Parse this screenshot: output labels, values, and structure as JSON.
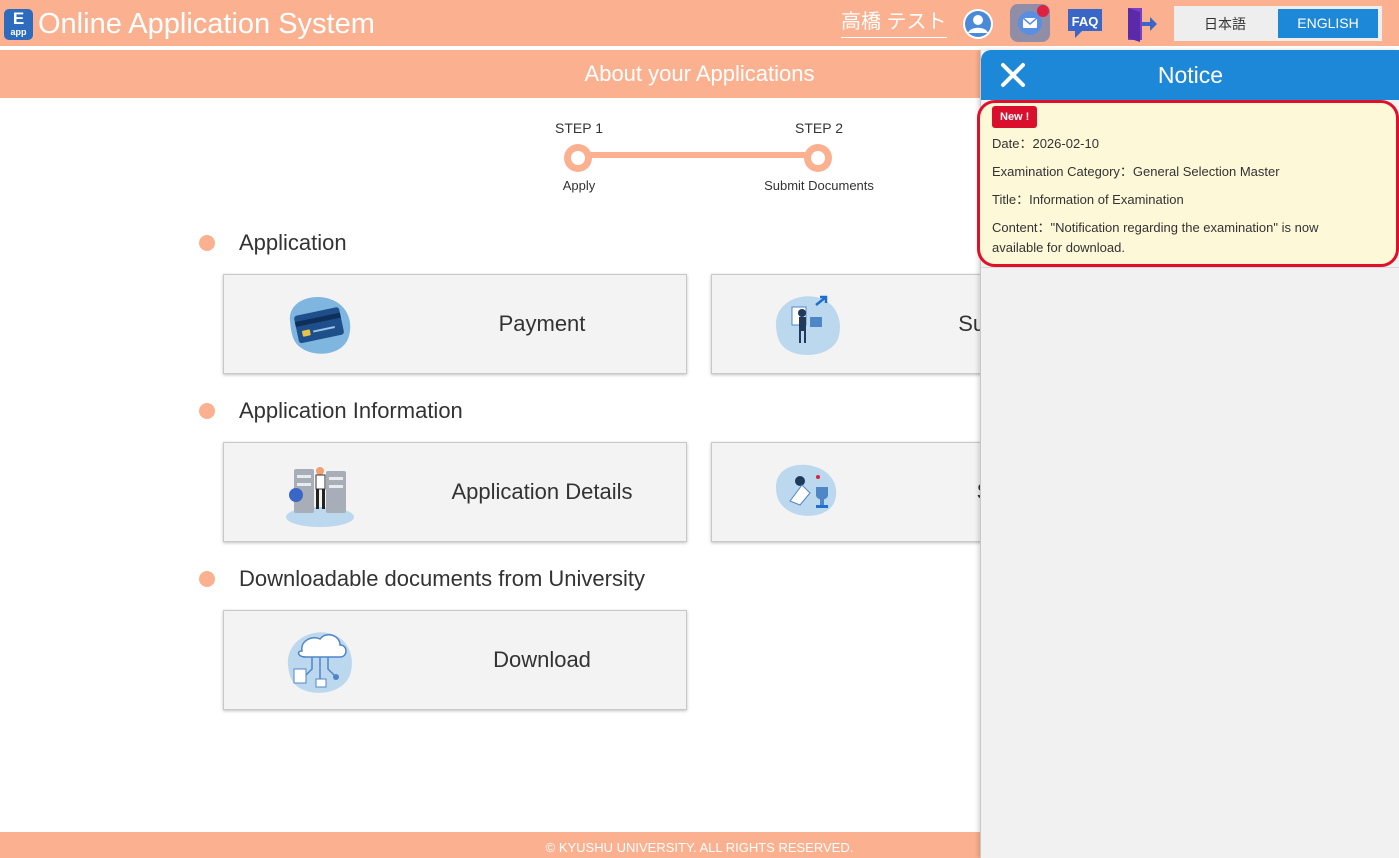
{
  "header": {
    "logo_letter": "E",
    "logo_sub": "app",
    "title": "Online Application System",
    "user_name": "高橋 テスト",
    "faq_label": "FAQ",
    "lang_ja": "日本語",
    "lang_en": "ENGLISH",
    "accent_color": "#fbb18f",
    "active_lang_color": "#1e88d8"
  },
  "band": {
    "title": "About your Applications"
  },
  "steps": [
    {
      "step": "STEP 1",
      "label": "Apply"
    },
    {
      "step": "STEP 2",
      "label": "Submit Documents"
    }
  ],
  "sections": [
    {
      "title": "Application",
      "cards": [
        {
          "label": "Payment",
          "icon": "credit-card-icon"
        },
        {
          "label": "Subm",
          "icon": "submit-documents-icon"
        }
      ]
    },
    {
      "title": "Application Information",
      "cards": [
        {
          "label": "Application Details",
          "icon": "server-person-icon"
        },
        {
          "label": "St",
          "icon": "status-trophy-icon"
        }
      ]
    },
    {
      "title": "Downloadable documents from University",
      "cards": [
        {
          "label": "Download",
          "icon": "cloud-download-icon"
        }
      ]
    }
  ],
  "footer": {
    "text": "© KYUSHU UNIVERSITY. ALL RIGHTS RESERVED."
  },
  "notice_panel": {
    "title": "Notice",
    "item": {
      "badge": "New !",
      "date": "Date：2026-02-10",
      "category": "Examination Category：General Selection Master",
      "title": "Title：Information of Examination",
      "content": "Content：\"Notification regarding the examination\" is now available for download."
    },
    "highlight_color": "#e0102a",
    "header_color": "#1e88d8"
  }
}
